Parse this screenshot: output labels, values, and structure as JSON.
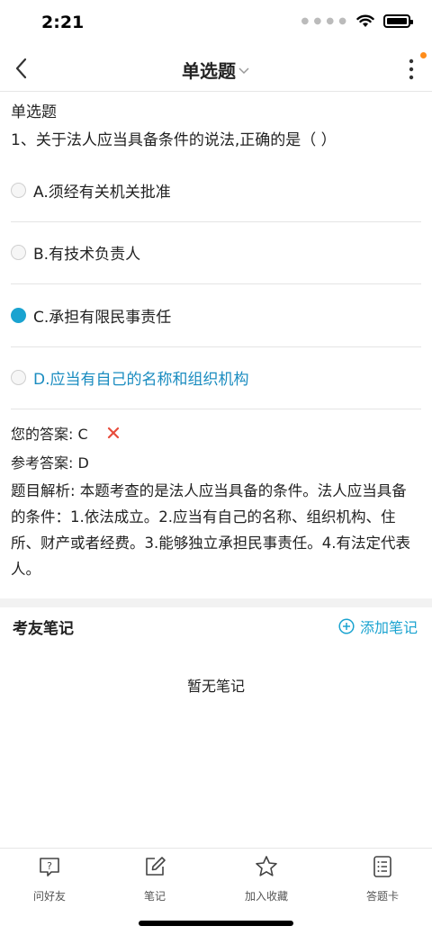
{
  "status_bar": {
    "time": "2:21"
  },
  "nav": {
    "title": "单选题"
  },
  "question": {
    "type_label": "单选题",
    "stem": "1、关于法人应当具备条件的说法,正确的是（ ）",
    "options": [
      {
        "label": "A.须经有关机关批准",
        "selected": false,
        "correct": false
      },
      {
        "label": "B.有技术负责人",
        "selected": false,
        "correct": false
      },
      {
        "label": "C.承担有限民事责任",
        "selected": true,
        "correct": false
      },
      {
        "label": "D.应当有自己的名称和组织机构",
        "selected": false,
        "correct": true
      }
    ]
  },
  "answer": {
    "your_answer": "您的答案: C",
    "reference_answer": "参考答案: D",
    "analysis": "题目解析: 本题考查的是法人应当具备的条件。法人应当具备的条件：1.依法成立。2.应当有自己的名称、组织机构、住所、财产或者经费。3.能够独立承担民事责任。4.有法定代表人。"
  },
  "notes": {
    "title": "考友笔记",
    "add_label": "添加笔记",
    "empty_text": "暂无笔记"
  },
  "tab_bar": {
    "items": [
      {
        "label": "问好友",
        "icon": "question-bubble-icon"
      },
      {
        "label": "笔记",
        "icon": "edit-note-icon"
      },
      {
        "label": "加入收藏",
        "icon": "star-icon"
      },
      {
        "label": "答题卡",
        "icon": "answer-sheet-icon"
      }
    ]
  },
  "colors": {
    "accent": "#1aa3d0",
    "correct_text": "#1a8cc0",
    "wrong_mark": "#e74c3c",
    "notify_dot": "#ff8c1a"
  }
}
